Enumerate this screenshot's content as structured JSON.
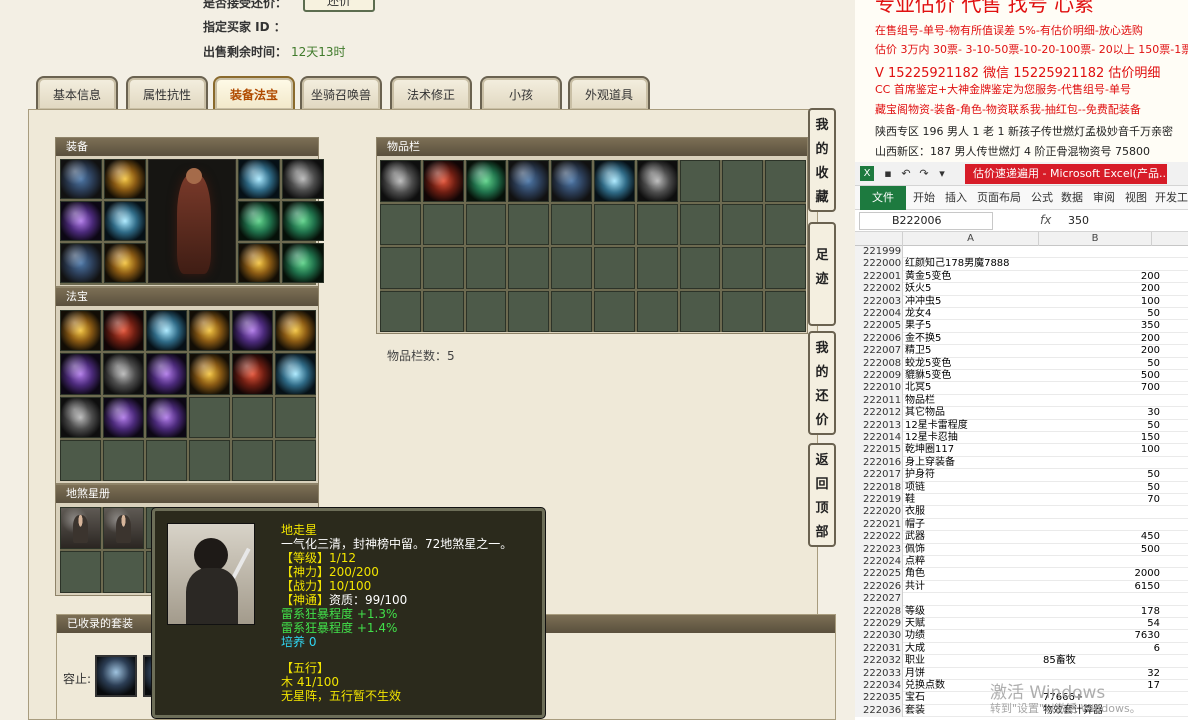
{
  "info": {
    "top_label": "是否接受还价：",
    "bid_button": "还价",
    "buyer_label": "指定买家 ID ：",
    "buyer_value": "",
    "remain_label": "出售剩余时间：",
    "remain_value": "12天13时"
  },
  "tabs": [
    "基本信息",
    "属性抗性",
    "装备法宝",
    "坐骑召唤兽",
    "法术修正",
    "小孩",
    "外观道具"
  ],
  "active_tab": "装备法宝",
  "sections": {
    "equip": "装备",
    "fabao": "法宝",
    "disha": "地煞星册",
    "inventory": "物品栏",
    "suits": "已收录的套装"
  },
  "item_count_label": "物品栏数：5",
  "suit_label": "容止:",
  "side_buttons": [
    [
      "我",
      "的",
      "收",
      "藏"
    ],
    [
      "足",
      "迹"
    ],
    [
      "我",
      "的",
      "还",
      "价"
    ],
    [
      "返",
      "回",
      "顶",
      "部"
    ]
  ],
  "tooltip": {
    "name": "地走星",
    "desc": "一气化三清，封神榜中留。72地煞星之一。",
    "level_label": "【等级】",
    "level": "1/12",
    "spirit_label": "【神力】",
    "spirit": "200/200",
    "combat_label": "【战力】",
    "combat": "10/100",
    "talent_label": "【神通】",
    "talent": "资质：99/100",
    "bonus1": "雷系狂暴程度 +1.3%",
    "bonus2": "雷系狂暴程度 +1.4%",
    "cultivate": "培养 0",
    "wuxing_label": "【五行】",
    "wuxing": "木 41/100",
    "wuxing_note": "无星阵，五行暂不生效"
  },
  "ad": {
    "heading": "专业估价 代售 找号 心累",
    "lines": [
      "在售组号-单号-物有所值误差 5%-有估价明细-放心选购",
      "估价 3万内 30票- 3-10-50票-10-20-100票- 20以上 150票-1票",
      "V 15225921182    微信 15225921182    估价明细",
      "CC 首席鉴定+大神金牌鉴定为您服务-代售组号-单号",
      "藏宝阁物资-装备-角色-物资联系我-抽红包--免费配装备",
      "陕西专区 196 男人 1 老 1 新孩子传世燃灯孟极妙音千万亲密",
      "山西新区：187 男人传世燃灯 4 阶正骨混物资号 75800"
    ]
  },
  "excel": {
    "window_title": "估价速递遍用 - Microsoft Excel(产品...",
    "menu": [
      "文件",
      "开始",
      "插入",
      "页面布局",
      "公式",
      "数据",
      "审阅",
      "视图",
      "开发工"
    ],
    "name_box": "B222006",
    "formula_value": "350",
    "col_a": "A",
    "col_b": "B",
    "rows": [
      [
        "221999",
        "",
        ""
      ],
      [
        "222000",
        "红颜知己178男魔7888",
        ""
      ],
      [
        "222001",
        "黄金5变色",
        "200"
      ],
      [
        "222002",
        "妖火5",
        "200"
      ],
      [
        "222003",
        "冲冲虫5",
        "100"
      ],
      [
        "222004",
        "龙女4",
        "50"
      ],
      [
        "222005",
        "果子5",
        "350"
      ],
      [
        "222006",
        "金不换5",
        "200"
      ],
      [
        "222007",
        "精卫5",
        "200"
      ],
      [
        "222008",
        "蛟龙5变色",
        "50"
      ],
      [
        "222009",
        "貔貅5变色",
        "500"
      ],
      [
        "222010",
        "北冥5",
        "700"
      ],
      [
        "222011",
        "物品栏",
        ""
      ],
      [
        "222012",
        "其它物品",
        "30"
      ],
      [
        "222013",
        "12星卡雷程度",
        "50"
      ],
      [
        "222014",
        "12星卡忍抽",
        "150"
      ],
      [
        "222015",
        "乾坤圈117",
        "100"
      ],
      [
        "222016",
        "身上穿装备",
        ""
      ],
      [
        "222017",
        "护身符",
        "50"
      ],
      [
        "222018",
        "项链",
        "50"
      ],
      [
        "222019",
        "鞋",
        "70"
      ],
      [
        "222020",
        "衣服",
        ""
      ],
      [
        "222021",
        "帽子",
        ""
      ],
      [
        "222022",
        "武器",
        "450"
      ],
      [
        "222023",
        "佩饰",
        "500"
      ],
      [
        "222024",
        "点粹",
        ""
      ],
      [
        "222025",
        "角色",
        "2000"
      ],
      [
        "222026",
        "共计",
        "6150"
      ],
      [
        "222027",
        "",
        ""
      ],
      [
        "222028",
        "等级",
        "178"
      ],
      [
        "222029",
        "天赋",
        "54"
      ],
      [
        "222030",
        "功绩",
        "7630"
      ],
      [
        "222031",
        "大成",
        "6"
      ],
      [
        "222032",
        "职业",
        "85畜牧"
      ],
      [
        "222033",
        "月饼",
        "32"
      ],
      [
        "222034",
        "兑换点数",
        "17"
      ],
      [
        "222035",
        "宝石",
        "77666+"
      ],
      [
        "222036",
        "套装",
        "物效套计算器"
      ]
    ]
  },
  "watermark": {
    "line1": "激活 Windows",
    "line2": "转到\"设置\"以激活 Windows。"
  }
}
